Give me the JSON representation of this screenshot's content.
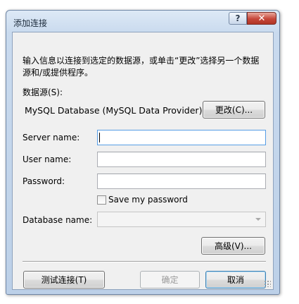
{
  "window": {
    "title": "添加连接",
    "help_label": "?",
    "close_label": "✕"
  },
  "description": "输入信息以连接到选定的数据源，或单击“更改”选择另一个数据源和/或提供程序。",
  "data_source": {
    "label": "数据源(S):",
    "value": "MySQL Database (MySQL Data Provider)",
    "change_button": "更改(C)..."
  },
  "fields": {
    "server_name": {
      "label": "Server name:",
      "value": ""
    },
    "user_name": {
      "label": "User name:",
      "value": ""
    },
    "password": {
      "label": "Password:",
      "value": ""
    },
    "save_password": {
      "label": "Save my password",
      "checked": false
    },
    "database_name": {
      "label": "Database name:",
      "value": ""
    }
  },
  "buttons": {
    "advanced": "高级(V)...",
    "test_connection": "测试连接(T)",
    "ok": "确定",
    "cancel": "取消"
  }
}
